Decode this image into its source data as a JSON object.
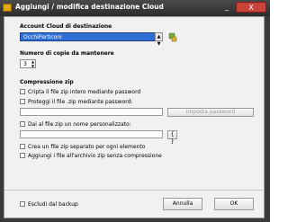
{
  "window": {
    "title": "Aggiungi / modifica destinazione Cloud",
    "minimize": "_",
    "close": "X"
  },
  "account": {
    "label": "Account Cloud di destinazione",
    "selected": "OcchiPerticoni"
  },
  "copies": {
    "label": "Numero di copie da mantenere",
    "value": "3"
  },
  "zip": {
    "label": "Compressione zip",
    "encrypt_label": "Cripta il file zip intero mediante password",
    "protect_label": "Proteggi il file .zip mediante password:",
    "set_password_label": "Imposta password",
    "custom_name_label": "Dai al file zip un nome personalizzato:",
    "separate_label": "Crea un file zip separato per ogni elemento",
    "no_compress_label": "Aggiungi i file all'archivio zip senza compressione"
  },
  "footer": {
    "exclude_label": "Escludi dal backup",
    "cancel_label": "Annulla",
    "ok_label": "OK"
  }
}
